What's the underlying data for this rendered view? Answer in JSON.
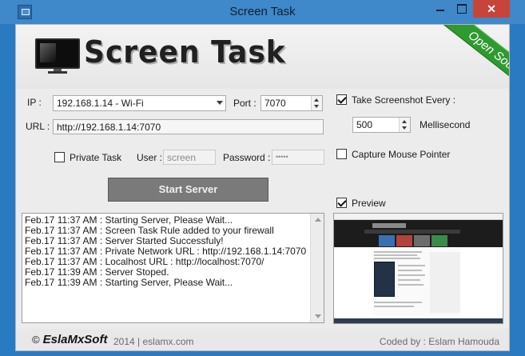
{
  "window": {
    "title": "Screen Task",
    "close_glyph": "✕",
    "accent_color": "#2a7ac2"
  },
  "header": {
    "logo_text": "Screen Task",
    "ribbon_text": "Open Source",
    "ribbon_color": "#2f9a2f",
    "logo_icon": "monitor-icon"
  },
  "connection": {
    "ip_label": "IP :",
    "ip_value": "192.168.1.14 - Wi-Fi",
    "port_label": "Port :",
    "port_value": "7070",
    "url_label": "URL :",
    "url_value": "http://192.168.1.14:7070",
    "private_task_label": "Private Task",
    "private_task_checked": false,
    "user_label": "User :",
    "user_value": "screen",
    "password_label": "Password :",
    "password_value": "•••••"
  },
  "screenshot": {
    "take_every_label": "Take Screenshot Every :",
    "take_every_checked": true,
    "interval_value": "500",
    "interval_unit": "Mellisecond",
    "capture_mouse_label": "Capture Mouse Pointer",
    "capture_mouse_checked": false,
    "preview_label": "Preview",
    "preview_checked": true
  },
  "actions": {
    "start_label": "Start Server"
  },
  "log": {
    "lines": [
      "Feb.17 11:37 AM : Starting Server, Please Wait...",
      "Feb.17 11:37 AM : Screen Task Rule added to your firewall",
      "Feb.17 11:37 AM : Server Started Successfuly!",
      "Feb.17 11:37 AM : Private Network URL : http://192.168.1.14:7070",
      "Feb.17 11:37 AM : Localhost URL : http://localhost:7070/",
      "Feb.17 11:39 AM : Server Stoped.",
      "Feb.17 11:39 AM : Starting Server, Please Wait..."
    ]
  },
  "footer": {
    "copyright_symbol": "©",
    "brand": "EslaMxSoft",
    "meta": "2014 | eslamx.com",
    "credit": "Coded by : Eslam Hamouda"
  }
}
